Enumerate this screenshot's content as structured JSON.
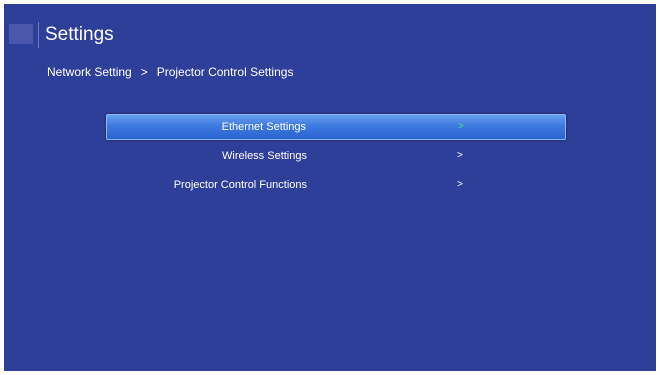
{
  "header": {
    "icon": "app-icon",
    "title": "Settings"
  },
  "breadcrumb": {
    "parent": "Network Setting",
    "separator": ">",
    "current": "Projector Control Settings"
  },
  "menu": {
    "items": [
      {
        "label": "Ethernet Settings",
        "arrow": ">",
        "selected": true
      },
      {
        "label": "Wireless Settings",
        "arrow": ">",
        "selected": false
      },
      {
        "label": "Projector Control Functions",
        "arrow": ">",
        "selected": false
      }
    ]
  },
  "colors": {
    "background": "#2e3f9a",
    "selection": "#3d7ae0",
    "selected_arrow": "#41e07a",
    "text": "#ffffff"
  }
}
